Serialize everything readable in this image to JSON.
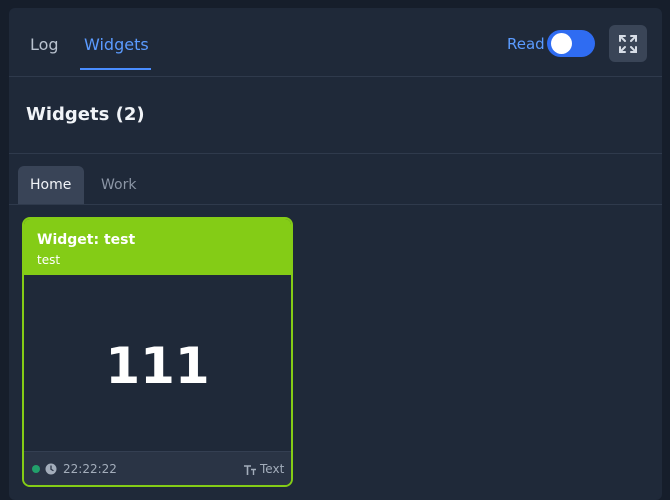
{
  "topbar": {
    "tabs": [
      {
        "label": "Log",
        "active": false
      },
      {
        "label": "Widgets",
        "active": true
      }
    ],
    "read_label": "Read",
    "read_toggle_on": true,
    "expand_icon": "expand-icon"
  },
  "header": {
    "title": "Widgets (2)"
  },
  "subtabs": [
    {
      "label": "Home",
      "active": true
    },
    {
      "label": "Work",
      "active": false
    }
  ],
  "widget": {
    "title": "Widget: test",
    "subtitle": "test",
    "value": "111",
    "time": "22:22:22",
    "type_label": "Text",
    "status_icon": "status-dot",
    "time_icon": "clock-icon",
    "type_icon": "text-type-icon"
  },
  "colors": {
    "accent": "#4a8dff",
    "widget_color": "#84cc16",
    "status_ok": "#22a06b"
  }
}
